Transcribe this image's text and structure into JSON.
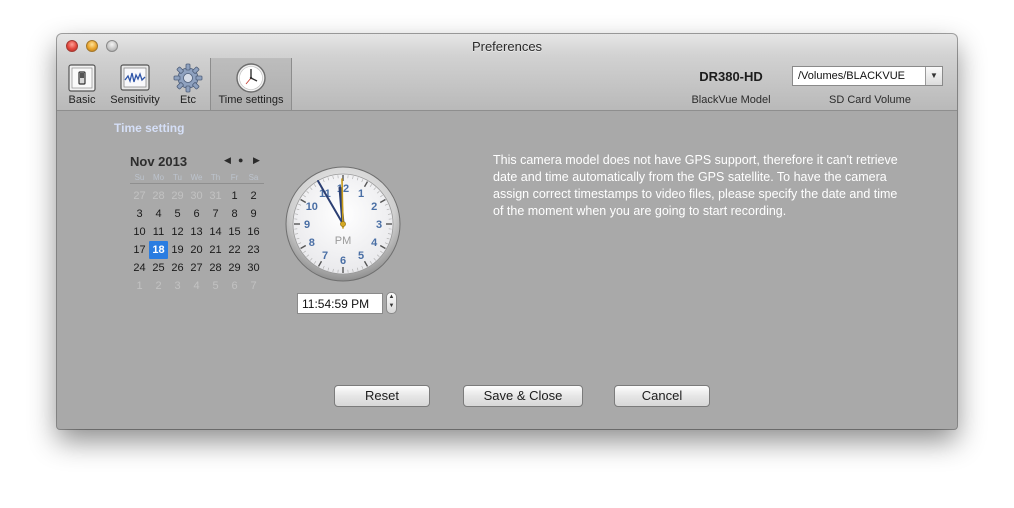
{
  "window": {
    "title": "Preferences"
  },
  "toolbar": {
    "items": [
      {
        "label": "Basic",
        "icon": "switch-icon",
        "selected": false
      },
      {
        "label": "Sensitivity",
        "icon": "waveform-monitor-icon",
        "selected": false
      },
      {
        "label": "Etc",
        "icon": "gear-icon",
        "selected": false
      },
      {
        "label": "Time settings",
        "icon": "clock-icon",
        "selected": true
      }
    ],
    "model": {
      "value": "DR380-HD",
      "caption": "BlackVue Model"
    },
    "volume": {
      "value": "/Volumes/BLACKVUE",
      "caption": "SD Card Volume"
    }
  },
  "time_setting": {
    "title": "Time setting",
    "calendar": {
      "month_label": "Nov 2013",
      "nav": {
        "prev": "◀",
        "today": "●",
        "next": "▶"
      },
      "weekdays": [
        "Su",
        "Mo",
        "Tu",
        "We",
        "Th",
        "Fr",
        "Sa"
      ],
      "weeks": [
        [
          "27",
          "28",
          "29",
          "30",
          "31",
          "1",
          "2"
        ],
        [
          "3",
          "4",
          "5",
          "6",
          "7",
          "8",
          "9"
        ],
        [
          "10",
          "11",
          "12",
          "13",
          "14",
          "15",
          "16"
        ],
        [
          "17",
          "18",
          "19",
          "20",
          "21",
          "22",
          "23"
        ],
        [
          "24",
          "25",
          "26",
          "27",
          "28",
          "29",
          "30"
        ],
        [
          "1",
          "2",
          "3",
          "4",
          "5",
          "6",
          "7"
        ]
      ],
      "selected_day": "18"
    },
    "clock": {
      "numbers": [
        "12",
        "1",
        "2",
        "3",
        "4",
        "5",
        "6",
        "7",
        "8",
        "9",
        "10",
        "11"
      ],
      "meridiem": "PM"
    },
    "time_value": "11:54:59  PM",
    "info": "This camera model does not have GPS support, therefore it can't retrieve date and time automatically from the GPS satellite. To have the camera assign correct timestamps to video files, please specify the date and time of the moment when you are going to start recording."
  },
  "buttons": {
    "reset": "Reset",
    "save": "Save & Close",
    "cancel": "Cancel"
  },
  "colors": {
    "selected_day": "#2a7de1",
    "section_title": "#d5dff7",
    "panel_bg": "#a9a9a9"
  }
}
